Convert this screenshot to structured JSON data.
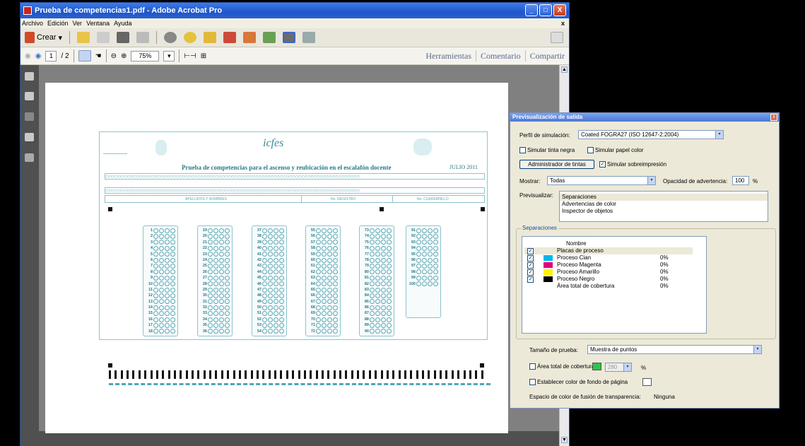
{
  "window": {
    "title": "Prueba de competencias1.pdf - Adobe Acrobat Pro",
    "controls": [
      "_",
      "□",
      "X"
    ]
  },
  "menubar": {
    "items": [
      "Archivo",
      "Edición",
      "Ver",
      "Ventana",
      "Ayuda"
    ],
    "close": "x"
  },
  "toolbar": {
    "crear_label": "Crear",
    "page_current": "1",
    "page_total": "/ 2",
    "zoom": "75%",
    "tabs": [
      "Herramientas",
      "Comentario",
      "Compartir"
    ]
  },
  "form": {
    "title": "Prueba de competencias para el ascenso y reubicación en el escalafón docente",
    "date": "JULIO 2011",
    "brand": "icfes",
    "field_labels": [
      "APELLIDOS Y NOMBRES",
      "No. REGISTRO",
      "No. CUADERNILLO"
    ],
    "column_starts": [
      1,
      19,
      37,
      55,
      73,
      91
    ],
    "column_counts": [
      18,
      18,
      18,
      18,
      18,
      10
    ]
  },
  "dialog": {
    "title": "Previsualización de salida",
    "close": "x",
    "perfil_label": "Perfil de simulación:",
    "perfil_value": "Coated FOGRA27 (ISO 12647-2:2004)",
    "simular_tinta_negra": "Simular tinta negra",
    "simular_papel_color": "Simular papel color",
    "admin_tintas": "Administrador de tintas",
    "simular_sobreimpresion": "Simular sobreimpresión",
    "mostrar_label": "Mostrar:",
    "mostrar_value": "Todas",
    "opacidad_label": "Opacidad de advertencia:",
    "opacidad_value": "100",
    "opacidad_unit": "%",
    "previsualizar_label": "Previsualizar:",
    "previsualizar_options": [
      "Separaciones",
      "Advertencias de color",
      "Inspector de objetos"
    ],
    "separaciones_group": "Separaciones",
    "sep_header": "Nombre",
    "separations": [
      {
        "checked": true,
        "name": "Placas de proceso",
        "swatch": "",
        "pct": ""
      },
      {
        "checked": true,
        "name": "Proceso Cian",
        "swatch": "#00b7eb",
        "pct": "0%"
      },
      {
        "checked": true,
        "name": "Proceso Magenta",
        "swatch": "#e4007c",
        "pct": "0%"
      },
      {
        "checked": true,
        "name": "Proceso Amarillo",
        "swatch": "#fff100",
        "pct": "0%"
      },
      {
        "checked": true,
        "name": "Proceso Negro",
        "swatch": "#000000",
        "pct": "0%"
      },
      {
        "checked": false,
        "name": "Área total de cobertura",
        "swatch": "",
        "pct": "0%"
      }
    ],
    "tamano_label": "Tamaño de prueba:",
    "tamano_value": "Muestra de puntos",
    "area_total_label": "Área total de cobertura",
    "area_total_value": "280",
    "area_total_unit": "%",
    "fondo_label": "Establecer color de fondo de página",
    "espacio_label": "Espacio de color de fusión de transparencia:",
    "espacio_value": "Ninguna"
  }
}
